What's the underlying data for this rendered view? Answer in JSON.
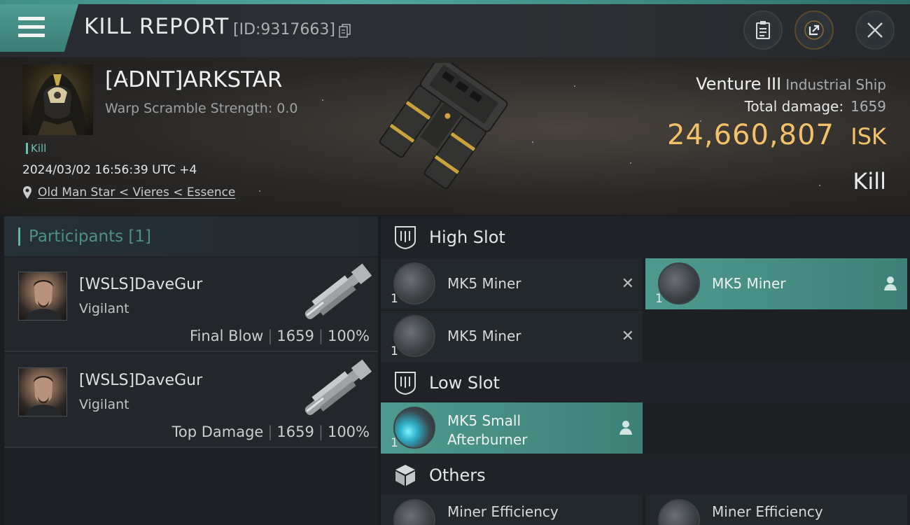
{
  "header": {
    "title": "KILL REPORT",
    "report_id": "[ID:9317663]",
    "icons": [
      "menu-icon",
      "copy-icon",
      "clipboard-icon",
      "share-icon",
      "close-icon"
    ]
  },
  "victim": {
    "name": "[ADNT]ARKSTAR",
    "warp_scramble": "Warp Scramble Strength: 0.0",
    "tag": "Kill",
    "timestamp": "2024/03/02 16:56:39 UTC +4",
    "location": "Old Man Star < Vieres < Essence"
  },
  "ship": {
    "name": "Venture III",
    "class": "Industrial Ship",
    "total_damage_label": "Total damage:",
    "total_damage": "1659",
    "isk_value": "24,660,807",
    "isk_unit": "ISK",
    "result": "Kill"
  },
  "participants": {
    "title": "Participants [1]",
    "items": [
      {
        "name": "[WSLS]DaveGur",
        "ship": "Vigilant",
        "role": "Final Blow",
        "damage": "1659",
        "percent": "100%"
      },
      {
        "name": "[WSLS]DaveGur",
        "ship": "Vigilant",
        "role": "Top Damage",
        "damage": "1659",
        "percent": "100%"
      }
    ]
  },
  "fitting": {
    "high_slot": {
      "title": "High Slot",
      "items": [
        {
          "name": "MK5 Miner",
          "qty": "1",
          "status": "destroyed"
        },
        {
          "name": "MK5 Miner",
          "qty": "1",
          "status": "dropped"
        },
        {
          "name": "MK5 Miner",
          "qty": "1",
          "status": "destroyed"
        }
      ]
    },
    "low_slot": {
      "title": "Low Slot",
      "items": [
        {
          "name_line1": "MK5 Small",
          "name_line2": "Afterburner",
          "qty": "1",
          "status": "dropped"
        }
      ]
    },
    "others": {
      "title": "Others",
      "items": [
        {
          "name": "Miner Efficiency"
        },
        {
          "name": "Miner Efficiency"
        }
      ]
    }
  },
  "colors": {
    "accent": "#4f9c92",
    "isk": "#f2c26b",
    "highlight_slot": "#4f9a8f"
  }
}
